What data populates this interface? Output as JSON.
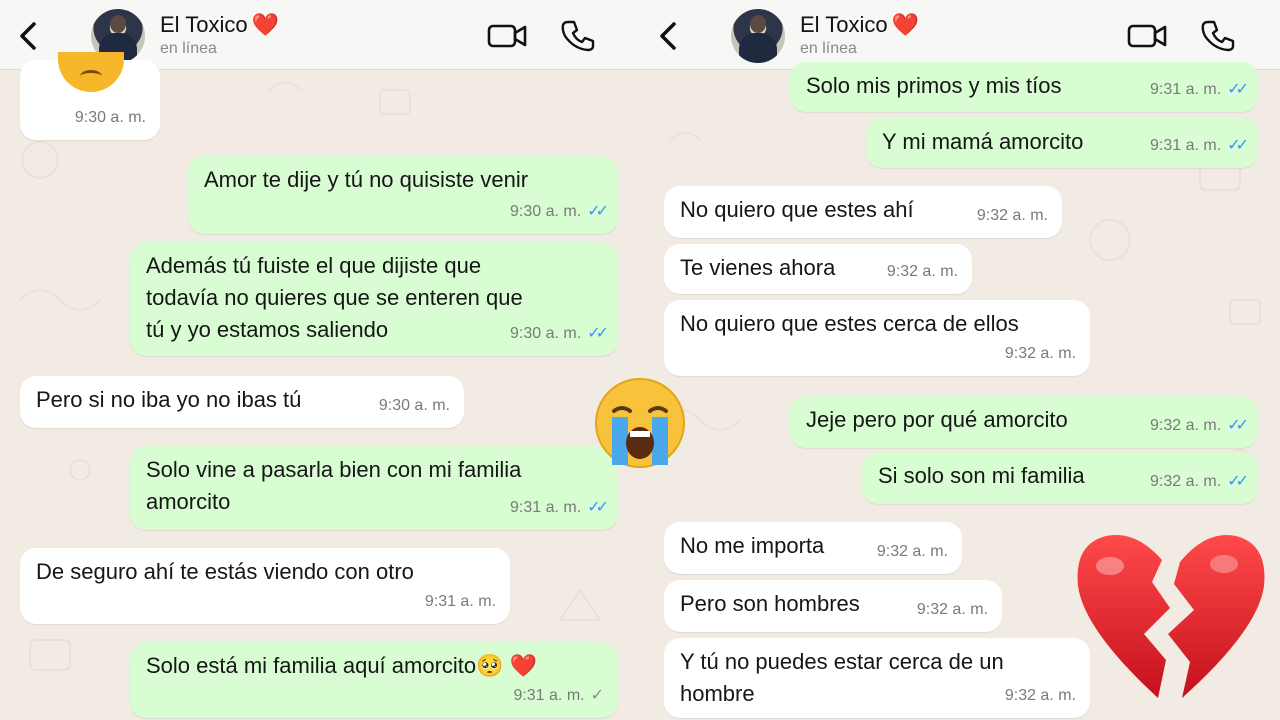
{
  "chats": [
    {
      "contact_name": "El Toxico",
      "heart_emoji": "❤️",
      "status": "en línea",
      "messages": [
        {
          "text": "",
          "time": "9:30 a. m.",
          "dir": "in"
        },
        {
          "text": "Amor te dije y tú no quisiste venir",
          "time": "9:30 a. m.",
          "dir": "out"
        },
        {
          "text": "Además tú fuiste el que dijiste que todavía no quieres que se enteren que tú y yo estamos saliendo",
          "time": "9:30 a. m.",
          "dir": "out"
        },
        {
          "text": "Pero si no iba yo no ibas tú",
          "time": "9:30 a. m.",
          "dir": "in"
        },
        {
          "text": "Solo vine a pasarla bien con mi familia amorcito",
          "time": "9:31 a. m.",
          "dir": "out"
        },
        {
          "text": "De seguro ahí te estás viendo con otro",
          "time": "9:31 a. m.",
          "dir": "in"
        },
        {
          "text": "Solo está mi familia aquí amorcito🥺 ❤️",
          "time": "9:31 a. m.",
          "dir": "out"
        }
      ]
    },
    {
      "contact_name": "El Toxico",
      "heart_emoji": "❤️",
      "status": "en línea",
      "messages": [
        {
          "text": "Solo mis primos y mis tíos",
          "time": "9:31 a. m.",
          "dir": "out"
        },
        {
          "text": "Y mi mamá amorcito",
          "time": "9:31 a. m.",
          "dir": "out"
        },
        {
          "text": "No quiero que estes ahí",
          "time": "9:32 a. m.",
          "dir": "in"
        },
        {
          "text": "Te vienes ahora",
          "time": "9:32 a. m.",
          "dir": "in"
        },
        {
          "text": "No quiero que estes cerca de ellos",
          "time": "9:32 a. m.",
          "dir": "in"
        },
        {
          "text": "Jeje pero por qué amorcito",
          "time": "9:32 a. m.",
          "dir": "out"
        },
        {
          "text": "Si solo son mi familia",
          "time": "9:32 a. m.",
          "dir": "out"
        },
        {
          "text": "No me importa",
          "time": "9:32 a. m.",
          "dir": "in"
        },
        {
          "text": "Pero son hombres",
          "time": "9:32 a. m.",
          "dir": "in"
        },
        {
          "text": "Y tú no puedes estar cerca de un hombre",
          "time": "9:32 a. m.",
          "dir": "in"
        }
      ]
    }
  ],
  "icons": {
    "back": "chevron-left-icon",
    "video_call": "video-camera-icon",
    "voice_call": "phone-icon",
    "read_receipt": "double-check-icon",
    "sent_receipt": "single-check-icon",
    "overlay_crying": "loudly-crying-face-emoji",
    "overlay_heart": "broken-heart-emoji"
  },
  "colors": {
    "incoming_bubble": "#ffffff",
    "outgoing_bubble": "#d8fdd2",
    "read_tick": "#3497f9",
    "wallpaper": "#f1ebe3",
    "header": "#f7f7f5"
  }
}
